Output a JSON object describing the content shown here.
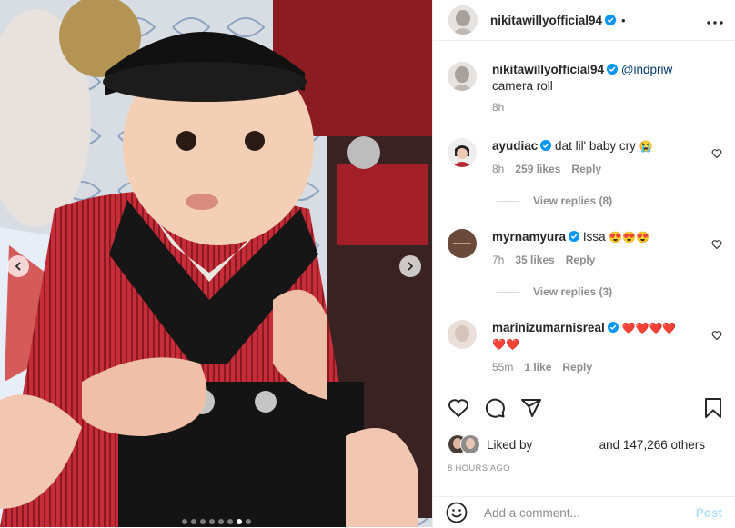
{
  "post": {
    "author": "nikitawillyofficial94",
    "separator": "•",
    "more_icon": "more-horizontal-icon",
    "caption": {
      "mention": "@indpriw",
      "text": "camera roll",
      "time": "8h"
    },
    "carousel": {
      "total": 8,
      "active": 7
    }
  },
  "comments": [
    {
      "user": "ayudiac",
      "text": "dat lil' baby cry",
      "emoji": "😭",
      "time": "8h",
      "likes": "259 likes",
      "reply": "Reply",
      "view_replies": "View replies (8)"
    },
    {
      "user": "myrnamyura",
      "text": "Issa",
      "emoji": "😍😍😍",
      "time": "7h",
      "likes": "35 likes",
      "reply": "Reply",
      "view_replies": "View replies (3)"
    },
    {
      "user": "marinizumarnisreal",
      "text": "",
      "emoji": "❤️❤️❤️❤️",
      "emoji2": "❤️❤️",
      "time": "55m",
      "likes": "1 like",
      "reply": "Reply"
    }
  ],
  "likes": {
    "prefix": "Liked by",
    "suffix": "and 147,266 others"
  },
  "timestamp": "8 HOURS AGO",
  "add_comment": {
    "placeholder": "Add a comment...",
    "post_label": "Post"
  },
  "colors": {
    "verified": "#0095f6",
    "heart": "#ed4956",
    "link": "#00376b",
    "muted": "#8e8e8e",
    "post_disabled": "#b2dffc"
  }
}
